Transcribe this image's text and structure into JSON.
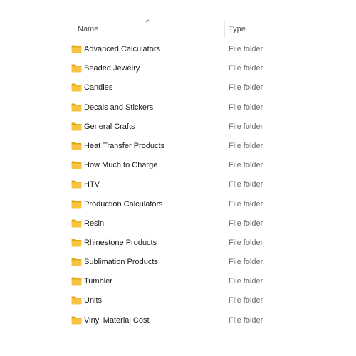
{
  "header": {
    "name_label": "Name",
    "type_label": "Type",
    "sort_icon": "chevron-up-icon"
  },
  "colors": {
    "folder_body": "#f8c440",
    "folder_tab": "#e4a70f",
    "name_text": "#1a1a1a",
    "type_text": "#6d6d6d"
  },
  "rows": [
    {
      "name": "Advanced Calculators",
      "type": "File folder"
    },
    {
      "name": "Beaded Jewelry",
      "type": "File folder"
    },
    {
      "name": "Candles",
      "type": "File folder"
    },
    {
      "name": "Decals and Stickers",
      "type": "File folder"
    },
    {
      "name": "General Crafts",
      "type": "File folder"
    },
    {
      "name": "Heat Transfer Products",
      "type": "File folder"
    },
    {
      "name": "How Much to Charge",
      "type": "File folder"
    },
    {
      "name": "HTV",
      "type": "File folder"
    },
    {
      "name": "Production Calculators",
      "type": "File folder"
    },
    {
      "name": "Resin",
      "type": "File folder"
    },
    {
      "name": "Rhinestone Products",
      "type": "File folder"
    },
    {
      "name": "Sublimation Products",
      "type": "File folder"
    },
    {
      "name": "Tumbler",
      "type": "File folder"
    },
    {
      "name": "Units",
      "type": "File folder"
    },
    {
      "name": "Vinyl Material Cost",
      "type": "File folder"
    }
  ]
}
